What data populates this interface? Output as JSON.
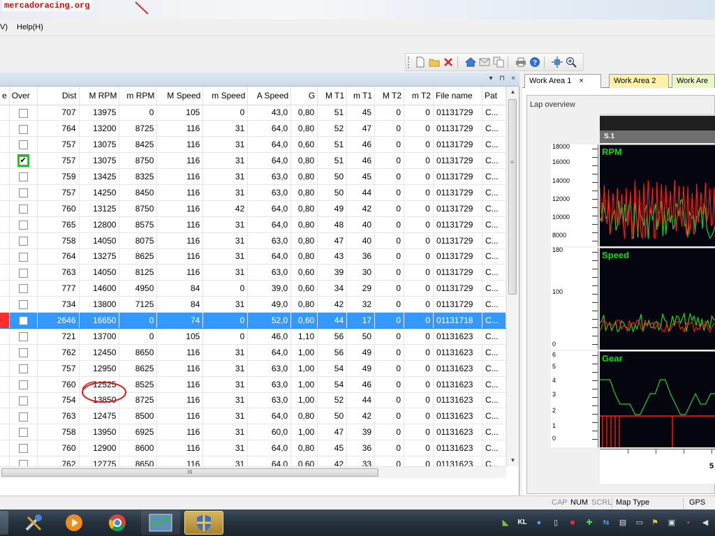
{
  "watermark": "mercadoracing.org",
  "menu": {
    "view_fragment": "V)",
    "help": "Help(H)"
  },
  "grid": {
    "columns": [
      "e",
      "Over",
      "Dist",
      "M RPM",
      "m RPM",
      "M Speed",
      "m Speed",
      "A Speed",
      "G",
      "M T1",
      "m T1",
      "M T2",
      "m T2",
      "File name",
      "Pat"
    ],
    "rows": [
      {
        "over": false,
        "cells": [
          "707",
          "13975",
          "0",
          "105",
          "0",
          "43,0",
          "0,80",
          "51",
          "45",
          "0",
          "0",
          "01131729",
          "C..."
        ]
      },
      {
        "over": false,
        "cells": [
          "764",
          "13200",
          "8725",
          "116",
          "31",
          "64,0",
          "0,80",
          "52",
          "47",
          "0",
          "0",
          "01131729",
          "C..."
        ]
      },
      {
        "over": false,
        "cells": [
          "757",
          "13075",
          "8425",
          "116",
          "31",
          "64,0",
          "0,60",
          "51",
          "46",
          "0",
          "0",
          "01131729",
          "C..."
        ]
      },
      {
        "over": true,
        "cells": [
          "757",
          "13075",
          "8750",
          "116",
          "31",
          "64,0",
          "0,80",
          "51",
          "46",
          "0",
          "0",
          "01131729",
          "C..."
        ]
      },
      {
        "over": false,
        "cells": [
          "759",
          "13425",
          "8325",
          "116",
          "31",
          "63,0",
          "0,80",
          "50",
          "45",
          "0",
          "0",
          "01131729",
          "C..."
        ]
      },
      {
        "over": false,
        "cells": [
          "757",
          "14250",
          "8450",
          "116",
          "31",
          "63,0",
          "0,80",
          "50",
          "44",
          "0",
          "0",
          "01131729",
          "C..."
        ]
      },
      {
        "over": false,
        "cells": [
          "760",
          "13125",
          "8750",
          "116",
          "42",
          "64,0",
          "0,80",
          "49",
          "42",
          "0",
          "0",
          "01131729",
          "C..."
        ]
      },
      {
        "over": false,
        "cells": [
          "765",
          "12800",
          "8575",
          "116",
          "31",
          "64,0",
          "0,80",
          "48",
          "40",
          "0",
          "0",
          "01131729",
          "C..."
        ]
      },
      {
        "over": false,
        "cells": [
          "758",
          "14050",
          "8075",
          "116",
          "31",
          "63,0",
          "0,80",
          "47",
          "40",
          "0",
          "0",
          "01131729",
          "C..."
        ]
      },
      {
        "over": false,
        "cells": [
          "764",
          "13275",
          "8625",
          "116",
          "31",
          "64,0",
          "0,80",
          "43",
          "36",
          "0",
          "0",
          "01131729",
          "C..."
        ]
      },
      {
        "over": false,
        "cells": [
          "763",
          "14050",
          "8125",
          "116",
          "31",
          "63,0",
          "0,60",
          "39",
          "30",
          "0",
          "0",
          "01131729",
          "C..."
        ]
      },
      {
        "over": false,
        "cells": [
          "777",
          "14600",
          "4950",
          "84",
          "0",
          "39,0",
          "0,60",
          "34",
          "29",
          "0",
          "0",
          "01131729",
          "C..."
        ]
      },
      {
        "over": false,
        "cells": [
          "734",
          "13800",
          "7125",
          "84",
          "31",
          "49,0",
          "0,80",
          "42",
          "32",
          "0",
          "0",
          "01131729",
          "C..."
        ]
      },
      {
        "over": false,
        "selected": true,
        "cells": [
          "2646",
          "16650",
          "0",
          "74",
          "0",
          "52,0",
          "0,60",
          "44",
          "17",
          "0",
          "0",
          "01131718",
          "C..."
        ]
      },
      {
        "over": false,
        "cells": [
          "721",
          "13700",
          "0",
          "105",
          "0",
          "46,0",
          "1,10",
          "56",
          "50",
          "0",
          "0",
          "01131623",
          "C..."
        ]
      },
      {
        "over": false,
        "cells": [
          "762",
          "12450",
          "8650",
          "116",
          "31",
          "64,0",
          "1,00",
          "56",
          "49",
          "0",
          "0",
          "01131623",
          "C..."
        ]
      },
      {
        "over": false,
        "cells": [
          "757",
          "12950",
          "8625",
          "116",
          "31",
          "63,0",
          "1,00",
          "54",
          "49",
          "0",
          "0",
          "01131623",
          "C..."
        ]
      },
      {
        "over": false,
        "cells": [
          "760",
          "12525",
          "8525",
          "116",
          "31",
          "63,0",
          "1,00",
          "54",
          "46",
          "0",
          "0",
          "01131623",
          "C..."
        ]
      },
      {
        "over": false,
        "cells": [
          "754",
          "13850",
          "8725",
          "116",
          "31",
          "63,0",
          "1,00",
          "52",
          "44",
          "0",
          "0",
          "01131623",
          "C..."
        ]
      },
      {
        "over": false,
        "cells": [
          "763",
          "12475",
          "8500",
          "116",
          "31",
          "64,0",
          "0,80",
          "50",
          "42",
          "0",
          "0",
          "01131623",
          "C..."
        ]
      },
      {
        "over": false,
        "cells": [
          "758",
          "13950",
          "6925",
          "116",
          "31",
          "60,0",
          "1,00",
          "47",
          "39",
          "0",
          "0",
          "01131623",
          "C..."
        ]
      },
      {
        "over": false,
        "cells": [
          "760",
          "12900",
          "8600",
          "116",
          "31",
          "64,0",
          "0,80",
          "45",
          "36",
          "0",
          "0",
          "01131623",
          "C..."
        ]
      },
      {
        "over": false,
        "cells": [
          "762",
          "12775",
          "8650",
          "116",
          "31",
          "64,0",
          "0,60",
          "42",
          "33",
          "0",
          "0",
          "01131623",
          "C..."
        ]
      }
    ]
  },
  "work_area": {
    "tabs": [
      {
        "label": "Work Area 1",
        "active": true,
        "close": "×"
      },
      {
        "label": "Work Area 2",
        "active": false
      },
      {
        "label": "Work Are",
        "active": false
      }
    ],
    "frame_title": "Lap overview",
    "segment_label": "S.1",
    "rpm": {
      "title": "RPM",
      "ticks": [
        "18000",
        "16000",
        "14000",
        "12000",
        "10000",
        "8000"
      ]
    },
    "speed": {
      "title": "Speed",
      "ticks": [
        "180",
        "100",
        "0"
      ]
    },
    "gear": {
      "title": "Gear",
      "ticks": [
        "6",
        "5",
        "4",
        "3",
        "2",
        "1",
        "0"
      ]
    },
    "x_label": "5",
    "colors": {
      "line_red": "#ff1a1a",
      "line_green": "#1fd21f",
      "plot_bg": "#05050f",
      "title_green": "#00e000"
    }
  },
  "status": {
    "cap": "CAP",
    "num": "NUM",
    "scrl": "SCRL",
    "map_type": "Map Type",
    "gps": "GPS"
  },
  "scroll": {
    "h_grip": "III"
  },
  "taskbar": {
    "apps": [
      "tools-app-icon",
      "media-player-icon",
      "chrome-icon",
      "map-app-icon",
      "shield-app-icon"
    ],
    "tray_letters": "KL"
  }
}
